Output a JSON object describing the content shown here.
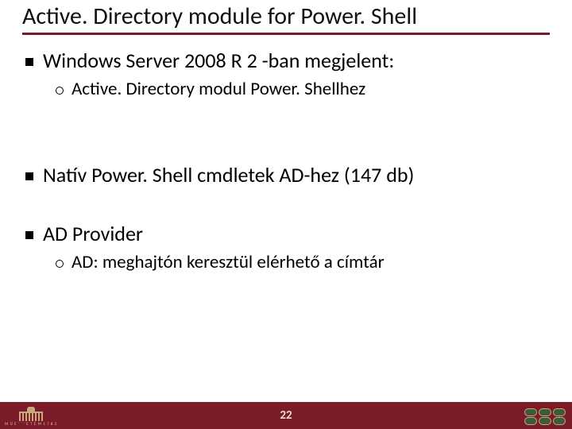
{
  "title": "Active. Directory module for Power. Shell",
  "bullets": [
    {
      "text": "Windows Server 2008 R 2 -ban megjelent:",
      "sub": [
        {
          "text": "Active. Directory modul Power. Shellhez"
        }
      ]
    },
    {
      "text": "Natív Power. Shell cmdletek AD-hez (147 db)"
    },
    {
      "text": "AD Provider",
      "sub": [
        {
          "text": "AD: meghajtón keresztül elérhető a címtár"
        }
      ]
    }
  ],
  "footer": {
    "page_number": "22",
    "left_logo_label": "M Ű E ˙ ˙ ˙ E T E M   1 7 8 2"
  },
  "colors": {
    "accent": "#7a1b2a",
    "footer_text": "#f0dfc6"
  }
}
